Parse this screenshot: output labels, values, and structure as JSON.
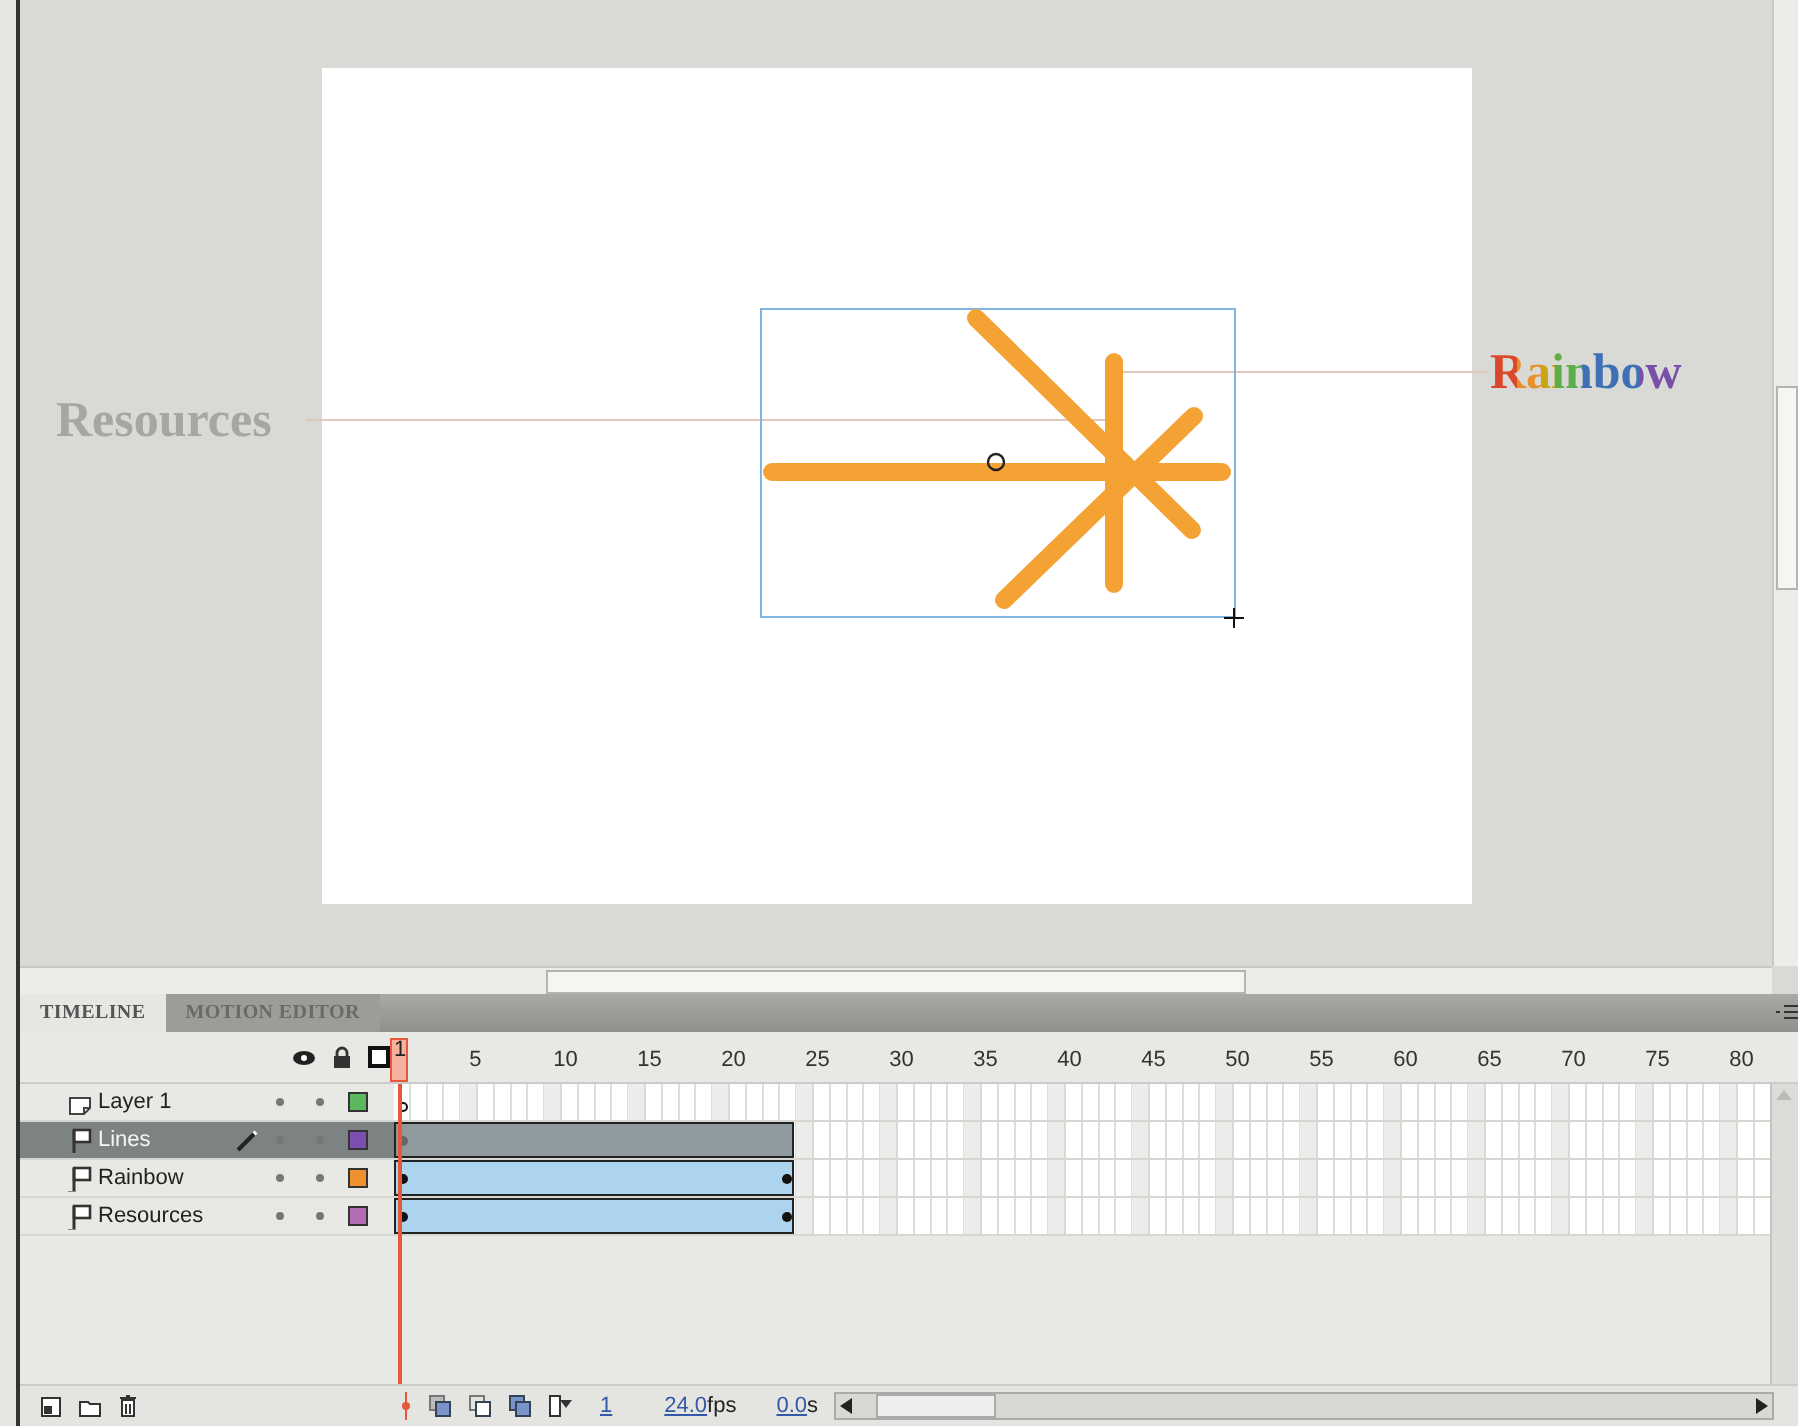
{
  "pasteboard": {
    "left_label": {
      "text": "Resources"
    },
    "right_label": {
      "text": "Rainbow"
    }
  },
  "tabs": [
    {
      "label": "TIMELINE",
      "selected": true
    },
    {
      "label": "MOTION EDITOR",
      "selected": false
    }
  ],
  "frame_numbers": [
    "1",
    "5",
    "10",
    "15",
    "20",
    "25",
    "30",
    "35",
    "40",
    "45",
    "50",
    "55",
    "60",
    "65",
    "70",
    "75",
    "80"
  ],
  "layers": [
    {
      "name": "Layer 1",
      "kind": "guide",
      "selected": false,
      "editing": false,
      "color": "#5cb85c",
      "empty_keyframe": true
    },
    {
      "name": "Lines",
      "kind": "guided",
      "selected": true,
      "editing": true,
      "color": "#7d4fb0",
      "level": 0.29,
      "end_keyframe": false
    },
    {
      "name": "Rainbow",
      "kind": "guided",
      "selected": false,
      "editing": false,
      "color": "#f0902c",
      "level": 0.29,
      "end_keyframe": true
    },
    {
      "name": "Resources",
      "kind": "guided",
      "selected": false,
      "editing": false,
      "color": "#b46db4",
      "level": 0.29,
      "end_keyframe": true
    }
  ],
  "status": {
    "current_frame": "1",
    "frame_rate": "24.0",
    "frame_rate_unit": "fps",
    "elapsed": "0.0",
    "elapsed_unit": "s"
  }
}
